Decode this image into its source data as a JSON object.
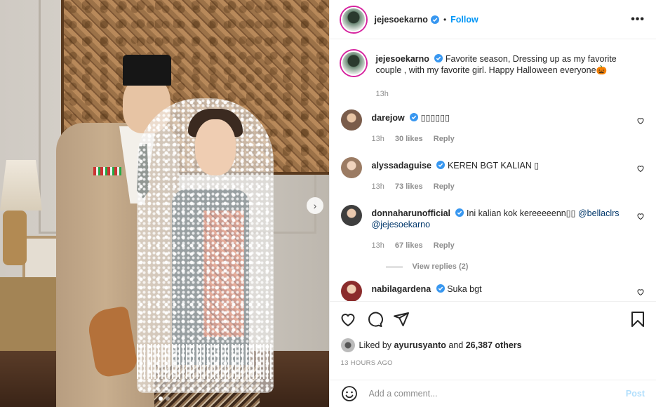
{
  "header": {
    "username": "jejesoekarno",
    "separator": "•",
    "follow_label": "Follow",
    "more_icon": "more-horizontal-icon"
  },
  "caption": {
    "username": "jejesoekarno",
    "text": "Favorite season, Dressing up as my favorite couple , with my favorite girl. Happy Halloween everyone🎃",
    "time": "13h"
  },
  "comments": [
    {
      "username": "darejow",
      "text": "▯▯▯▯▯▯",
      "time": "13h",
      "likes": "30 likes",
      "reply": "Reply",
      "avatar_color": "#7a5c4a"
    },
    {
      "username": "alyssadaguise",
      "text": "KEREN BGT KALIAN ▯",
      "time": "13h",
      "likes": "73 likes",
      "reply": "Reply",
      "avatar_color": "#9b7b63"
    },
    {
      "username": "donnaharunofficial",
      "text": "Ini kalian kok kereeeeenn▯▯",
      "mention1": "@bellaclrs",
      "mention2": "@jejesoekarno",
      "time": "13h",
      "likes": "67 likes",
      "reply": "Reply",
      "avatar_color": "#3e3e3e",
      "view_replies": "View replies (2)"
    },
    {
      "username": "nabilagardena",
      "text": "Suka bgt",
      "avatar_color": "#8b2c2c"
    }
  ],
  "likes": {
    "prefix": "Liked by",
    "user": "ayurusyanto",
    "middle": "and",
    "count": "26,387 others"
  },
  "timestamp": "13 HOURS AGO",
  "add_comment": {
    "placeholder": "Add a comment...",
    "post_label": "Post"
  },
  "carousel": {
    "dots": 2,
    "active": 0
  },
  "colors": {
    "accent": "#0095f6",
    "verified": "#3897f0",
    "muted": "#8e8e8e"
  }
}
